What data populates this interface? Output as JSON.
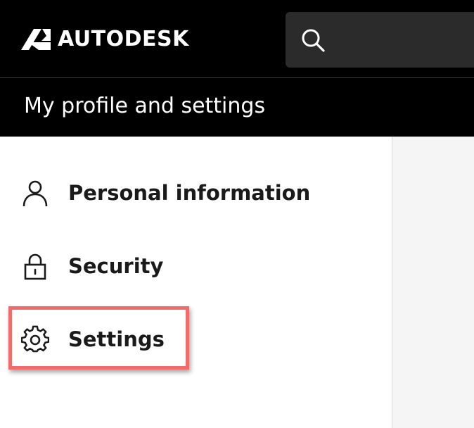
{
  "header": {
    "brand": "AUTODESK",
    "search_placeholder": ""
  },
  "subheader": {
    "title": "My profile and settings"
  },
  "sidebar": {
    "items": [
      {
        "label": "Personal information",
        "icon": "person-icon"
      },
      {
        "label": "Security",
        "icon": "lock-icon"
      },
      {
        "label": "Settings",
        "icon": "gear-icon",
        "highlighted": true
      }
    ]
  },
  "colors": {
    "header_bg": "#000000",
    "search_bg": "#2b2b2b",
    "highlight": "#f26b6b",
    "content_bg": "#f5f5f5"
  }
}
